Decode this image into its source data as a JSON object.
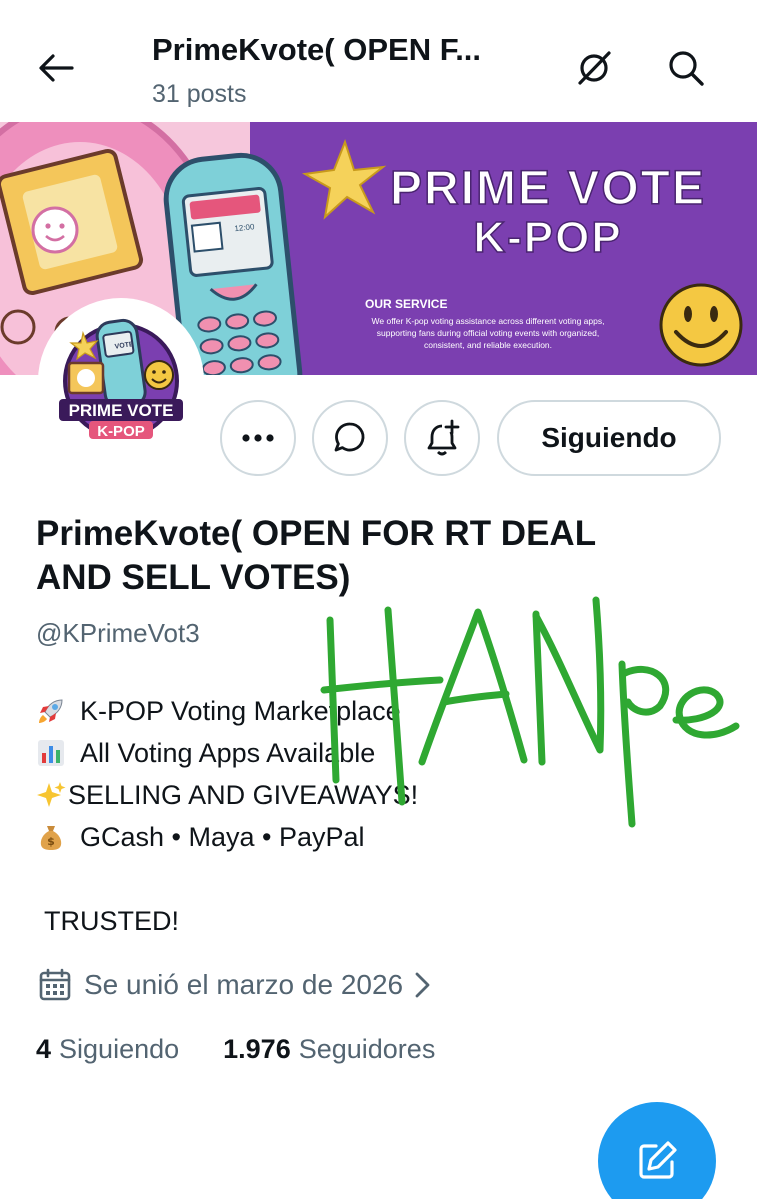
{
  "header": {
    "title": "PrimeKvote( OPEN F...",
    "posts_count": "31 posts"
  },
  "banner": {
    "headline_1": "PRIME VOTE",
    "headline_2": "K-POP",
    "service_title": "OUR SERVICE",
    "service_text_1": "We offer K-pop voting assistance across different voting apps,",
    "service_text_2": "supporting fans during official voting events with organized,",
    "service_text_3": "consistent, and reliable execution.",
    "phone_screen_text": "12:00",
    "colors": {
      "purple": "#7b3fb0",
      "pink": "#f2a0c8"
    }
  },
  "avatar": {
    "logo_line_1": "PRIME VOTE",
    "logo_line_2": "K-POP",
    "phone_text": "VOTE"
  },
  "actions": {
    "follow_label": "Siguiendo"
  },
  "profile": {
    "display_name": "PrimeKvote( OPEN FOR RT DEAL AND SELL VOTES)",
    "handle": "@KPrimeVot3",
    "bio": [
      {
        "emoji": "rocket",
        "text": "K-POP Voting Marketplace"
      },
      {
        "emoji": "bar-chart",
        "text": "All Voting Apps Available"
      },
      {
        "emoji": "sparkles",
        "text": "SELLING AND GIVEAWAYS!"
      },
      {
        "emoji": "money-bag",
        "text": "GCash • Maya • PayPal"
      }
    ],
    "trusted": "TRUSTED!",
    "joined": "Se unió el marzo de 2026"
  },
  "stats": {
    "following_count": "4",
    "following_label": "Siguiendo",
    "followers_count": "1.976",
    "followers_label": "Seguidores"
  },
  "handwriting": "HANpe",
  "accent_color": "#1d9bf0"
}
